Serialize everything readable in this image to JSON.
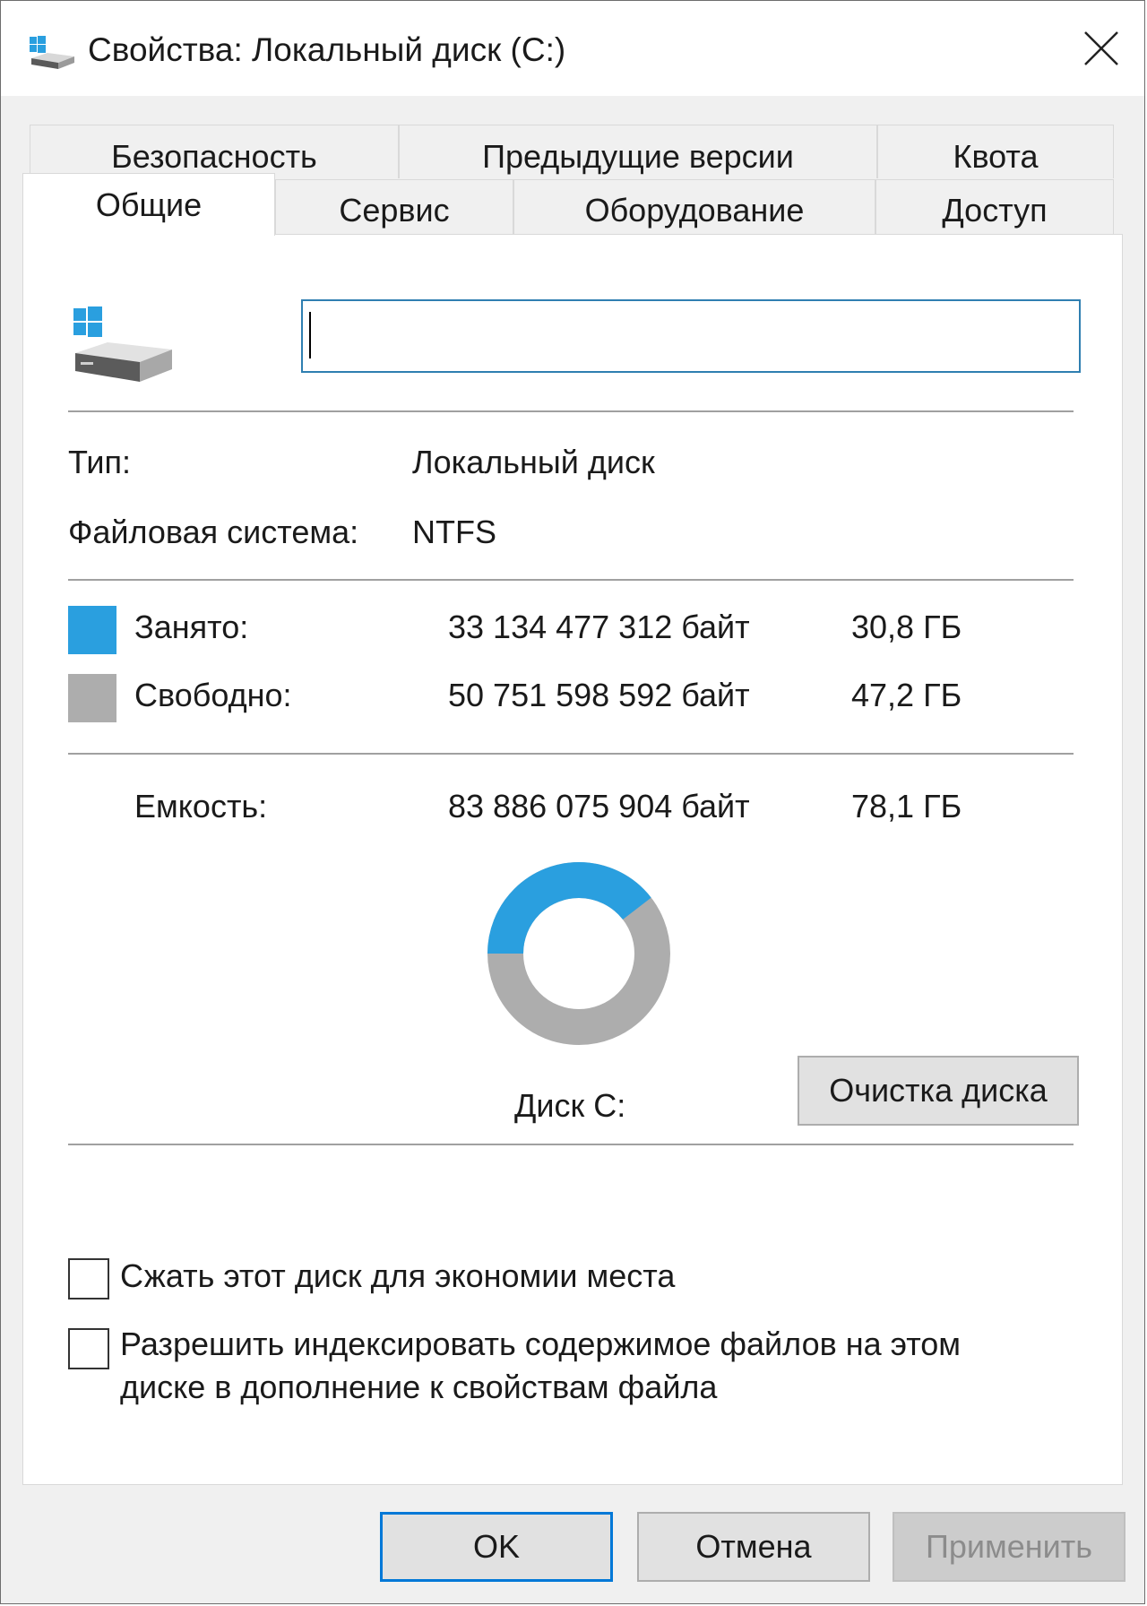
{
  "window": {
    "title": "Свойства: Локальный диск (C:)"
  },
  "tabs": {
    "row1": [
      "Безопасность",
      "Предыдущие версии",
      "Квота"
    ],
    "row2": [
      "Общие",
      "Сервис",
      "Оборудование",
      "Доступ"
    ],
    "active": "Общие"
  },
  "general": {
    "name_input_value": "",
    "type_label": "Тип:",
    "type_value": "Локальный диск",
    "fs_label": "Файловая система:",
    "fs_value": "NTFS",
    "used_label": "Занято:",
    "used_bytes": "33 134 477 312 байт",
    "used_gb": "30,8 ГБ",
    "free_label": "Свободно:",
    "free_bytes": "50 751 598 592 байт",
    "free_gb": "47,2 ГБ",
    "capacity_label": "Емкость:",
    "capacity_bytes": "83 886 075 904 байт",
    "capacity_gb": "78,1 ГБ",
    "used_fraction": 0.395,
    "drive_label": "Диск C:",
    "cleanup_button": "Очистка диска",
    "compress_checkbox": {
      "label": "Сжать этот диск для экономии места",
      "checked": false
    },
    "index_checkbox": {
      "label_line1": "Разрешить индексировать содержимое файлов на этом",
      "label_line2": "диске в дополнение к свойствам файла",
      "checked": false
    }
  },
  "buttons": {
    "ok": "OK",
    "cancel": "Отмена",
    "apply": "Применить"
  },
  "colors": {
    "used": "#2a9fdf",
    "free": "#adadad",
    "accent": "#0078d7"
  },
  "icons": {
    "title": "drive-icon",
    "close": "close-icon",
    "drive": "drive-icon"
  }
}
